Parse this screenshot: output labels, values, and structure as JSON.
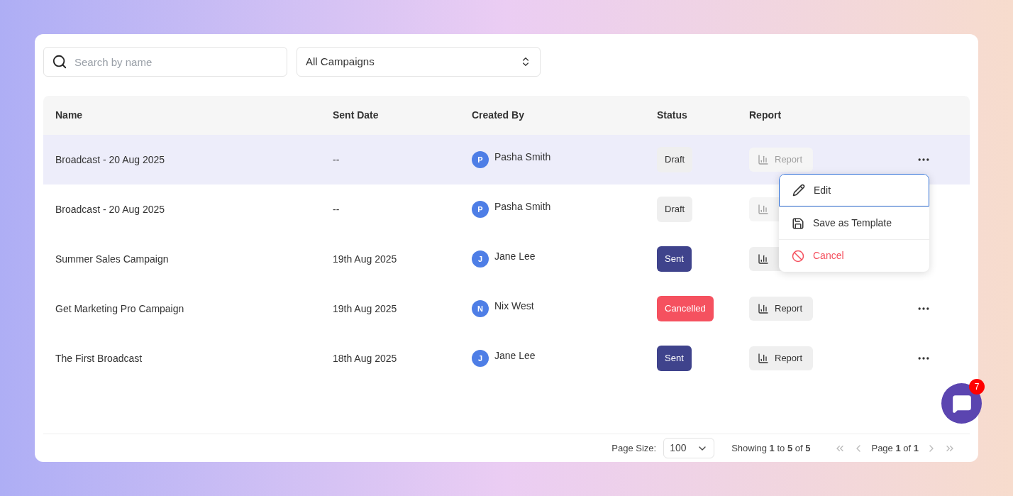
{
  "search": {
    "placeholder": "Search by name"
  },
  "filter": {
    "value": "All Campaigns"
  },
  "table": {
    "columns": [
      "Name",
      "Sent Date",
      "Created By",
      "Status",
      "Report"
    ],
    "rows": [
      {
        "name": "Broadcast - 20 Aug 2025",
        "sent_date": "--",
        "avatar": "P",
        "created_by": "Pasha Smith",
        "status": "Draft",
        "kind": "draft",
        "report": "Report",
        "report_disabled": true,
        "selected": true
      },
      {
        "name": "Broadcast - 20 Aug 2025",
        "sent_date": "--",
        "avatar": "P",
        "created_by": "Pasha Smith",
        "status": "Draft",
        "kind": "draft",
        "report_disabled": true,
        "selected": false
      },
      {
        "name": "Summer Sales Campaign",
        "sent_date": "19th Aug 2025",
        "avatar": "J",
        "created_by": "Jane Lee",
        "status": "Sent",
        "kind": "sent",
        "report_disabled": false,
        "selected": false
      },
      {
        "name": "Get Marketing Pro Campaign",
        "sent_date": "19th Aug 2025",
        "avatar": "N",
        "created_by": "Nix West",
        "status": "Cancelled",
        "kind": "cancelled",
        "report": "Report",
        "report_disabled": false,
        "selected": false
      },
      {
        "name": "The First Broadcast",
        "sent_date": "18th Aug 2025",
        "avatar": "J",
        "created_by": "Jane Lee",
        "status": "Sent",
        "kind": "sent",
        "report": "Report",
        "report_disabled": false,
        "selected": false
      }
    ]
  },
  "menu": {
    "items": [
      {
        "kind": "edit",
        "label": "Edit",
        "selected": true
      },
      {
        "kind": "save",
        "label": "Save as Template",
        "selected": false
      },
      {
        "kind": "cancel",
        "label": "Cancel",
        "selected": false
      }
    ]
  },
  "footer": {
    "page_size_label": "Page Size:",
    "page_size": "100",
    "showing": "Showing **1** to **5** of **5**",
    "page": "Page **1** of **1**"
  },
  "chat": {
    "badge": "7"
  }
}
